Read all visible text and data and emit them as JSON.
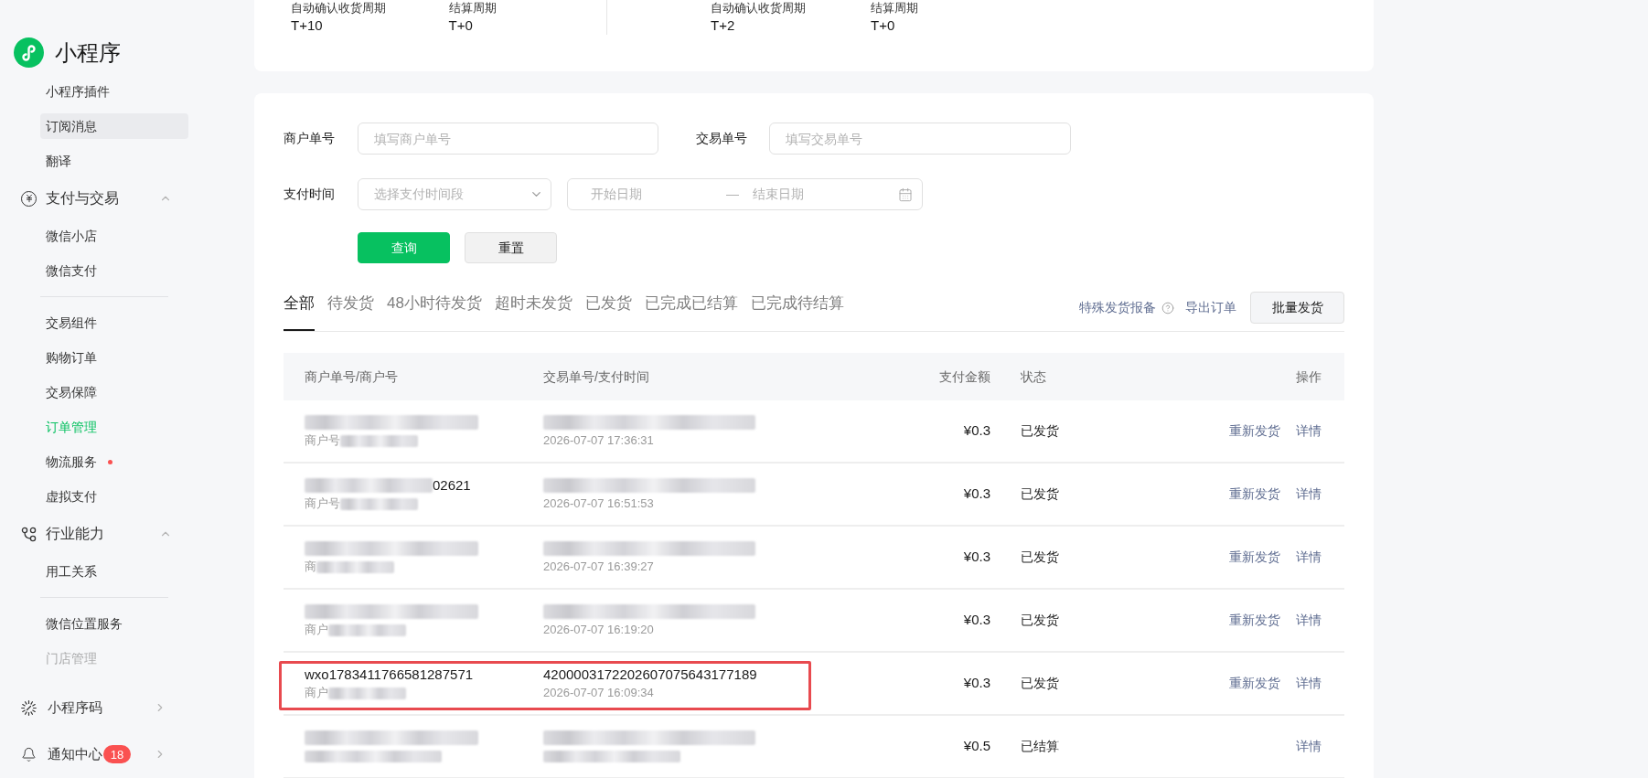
{
  "sidebar": {
    "title": "小程序",
    "items": [
      {
        "kind": "link",
        "label": "小程序插件",
        "selected": false,
        "highlighted": false,
        "dot": false,
        "faded": false
      },
      {
        "kind": "link",
        "label": "订阅消息",
        "selected": false,
        "highlighted": true,
        "dot": false,
        "faded": false
      },
      {
        "kind": "link",
        "label": "翻译",
        "selected": false,
        "highlighted": false,
        "dot": false,
        "faded": false
      },
      {
        "kind": "group",
        "label": "支付与交易",
        "expanded": true,
        "children": [
          {
            "kind": "link",
            "label": "微信小店",
            "selected": false,
            "highlighted": false,
            "dot": false,
            "faded": false
          },
          {
            "kind": "link",
            "label": "微信支付",
            "selected": false,
            "highlighted": false,
            "dot": false,
            "faded": false
          },
          {
            "kind": "divider"
          },
          {
            "kind": "link",
            "label": "交易组件",
            "selected": false,
            "highlighted": false,
            "dot": false,
            "faded": false
          },
          {
            "kind": "link",
            "label": "购物订单",
            "selected": false,
            "highlighted": false,
            "dot": false,
            "faded": false
          },
          {
            "kind": "link",
            "label": "交易保障",
            "selected": false,
            "highlighted": false,
            "dot": false,
            "faded": false
          },
          {
            "kind": "link",
            "label": "订单管理",
            "selected": true,
            "highlighted": false,
            "dot": false,
            "faded": false
          },
          {
            "kind": "link",
            "label": "物流服务",
            "selected": false,
            "highlighted": false,
            "dot": true,
            "faded": false
          },
          {
            "kind": "link",
            "label": "虚拟支付",
            "selected": false,
            "highlighted": false,
            "dot": false,
            "faded": false
          }
        ]
      },
      {
        "kind": "group",
        "label": "行业能力",
        "expanded": true,
        "children": [
          {
            "kind": "link",
            "label": "用工关系",
            "selected": false,
            "highlighted": false,
            "dot": false,
            "faded": false
          },
          {
            "kind": "divider"
          },
          {
            "kind": "link",
            "label": "微信位置服务",
            "selected": false,
            "highlighted": false,
            "dot": false,
            "faded": false
          },
          {
            "kind": "link",
            "label": "门店管理",
            "selected": false,
            "highlighted": false,
            "dot": false,
            "faded": true
          }
        ]
      }
    ],
    "footer": [
      {
        "label": "小程序码",
        "expanded": false
      },
      {
        "label": "通知中心",
        "badge": "18",
        "expanded": false
      }
    ]
  },
  "settlement": [
    {
      "items": [
        {
          "label": "自动确认收货周期",
          "value": "T+10"
        },
        {
          "label": "结算周期",
          "value": "T+0"
        }
      ]
    },
    {
      "items": [
        {
          "label": "自动确认收货周期",
          "value": "T+2"
        },
        {
          "label": "结算周期",
          "value": "T+0"
        }
      ]
    }
  ],
  "filters": {
    "merchant_order": {
      "label": "商户单号",
      "placeholder": "填写商户单号"
    },
    "transaction_id": {
      "label": "交易单号",
      "placeholder": "填写交易单号"
    },
    "pay_time": {
      "label": "支付时间",
      "placeholder": "选择支付时间段",
      "start_placeholder": "开始日期",
      "separator": "—",
      "end_placeholder": "结束日期"
    },
    "buttons": [
      {
        "label": "查询",
        "kind": "primary"
      },
      {
        "label": "重置",
        "kind": "secondary"
      }
    ]
  },
  "tabs": [
    {
      "label": "全部",
      "selected": true
    },
    {
      "label": "待发货",
      "selected": false
    },
    {
      "label": "48小时待发货",
      "selected": false
    },
    {
      "label": "超时未发货",
      "selected": false
    },
    {
      "label": "已发货",
      "selected": false
    },
    {
      "label": "已完成已结算",
      "selected": false
    },
    {
      "label": "已完成待结算",
      "selected": false
    }
  ],
  "toolbar": {
    "links": [
      {
        "label": "特殊发货报备",
        "help": true
      },
      {
        "label": "导出订单",
        "help": false
      }
    ],
    "button": "批量发货"
  },
  "table": {
    "columns": [
      "商户单号/商户号",
      "交易单号/支付时间",
      "支付金额",
      "状态",
      "操作"
    ],
    "rows": [
      {
        "merchant_order": [
          {
            "kind": "blur"
          }
        ],
        "merchant_no": [
          {
            "kind": "text",
            "text": "商户号"
          },
          {
            "kind": "blur"
          }
        ],
        "transaction_id": [
          {
            "kind": "blur"
          }
        ],
        "pay_time": [
          {
            "kind": "text",
            "text": "2026-07-07 17:36:31"
          }
        ],
        "amount": "¥0.3",
        "status": "已发货",
        "actions": [
          "重新发货",
          "详情"
        ],
        "highlighted": false
      },
      {
        "merchant_order": [
          {
            "kind": "blur"
          },
          {
            "kind": "text",
            "text": "02621"
          }
        ],
        "merchant_no": [
          {
            "kind": "text",
            "text": "商户号"
          },
          {
            "kind": "blur"
          }
        ],
        "transaction_id": [
          {
            "kind": "blur"
          }
        ],
        "pay_time": [
          {
            "kind": "text",
            "text": "2026-07-07 16:51:53"
          }
        ],
        "amount": "¥0.3",
        "status": "已发货",
        "actions": [
          "重新发货",
          "详情"
        ],
        "highlighted": false
      },
      {
        "merchant_order": [
          {
            "kind": "blur"
          }
        ],
        "merchant_no": [
          {
            "kind": "text",
            "text": "商"
          },
          {
            "kind": "blur"
          }
        ],
        "transaction_id": [
          {
            "kind": "blur"
          }
        ],
        "pay_time": [
          {
            "kind": "text",
            "text": "2026-07-07 16:39:27"
          }
        ],
        "amount": "¥0.3",
        "status": "已发货",
        "actions": [
          "重新发货",
          "详情"
        ],
        "highlighted": false
      },
      {
        "merchant_order": [
          {
            "kind": "blur"
          }
        ],
        "merchant_no": [
          {
            "kind": "text",
            "text": "商户"
          },
          {
            "kind": "blur"
          }
        ],
        "transaction_id": [
          {
            "kind": "blur"
          }
        ],
        "pay_time": [
          {
            "kind": "text",
            "text": "2026-07-07 16:19:20"
          }
        ],
        "amount": "¥0.3",
        "status": "已发货",
        "actions": [
          "重新发货",
          "详情"
        ],
        "highlighted": false
      },
      {
        "merchant_order": [
          {
            "kind": "text",
            "text": "wxo1783411766581287571"
          }
        ],
        "merchant_no": [
          {
            "kind": "text",
            "text": "商户"
          },
          {
            "kind": "blur"
          }
        ],
        "transaction_id": [
          {
            "kind": "text",
            "text": "4200003172202607075643177189"
          }
        ],
        "pay_time": [
          {
            "kind": "text",
            "text": "2026-07-07 16:09:34"
          }
        ],
        "amount": "¥0.3",
        "status": "已发货",
        "actions": [
          "重新发货",
          "详情"
        ],
        "highlighted": true
      },
      {
        "merchant_order": [
          {
            "kind": "blur"
          }
        ],
        "merchant_no": [
          {
            "kind": "blur"
          }
        ],
        "transaction_id": [
          {
            "kind": "blur"
          }
        ],
        "pay_time": [
          {
            "kind": "blur"
          }
        ],
        "amount": "¥0.5",
        "status": "已结算",
        "actions": [
          "详情"
        ],
        "highlighted": false
      }
    ]
  }
}
